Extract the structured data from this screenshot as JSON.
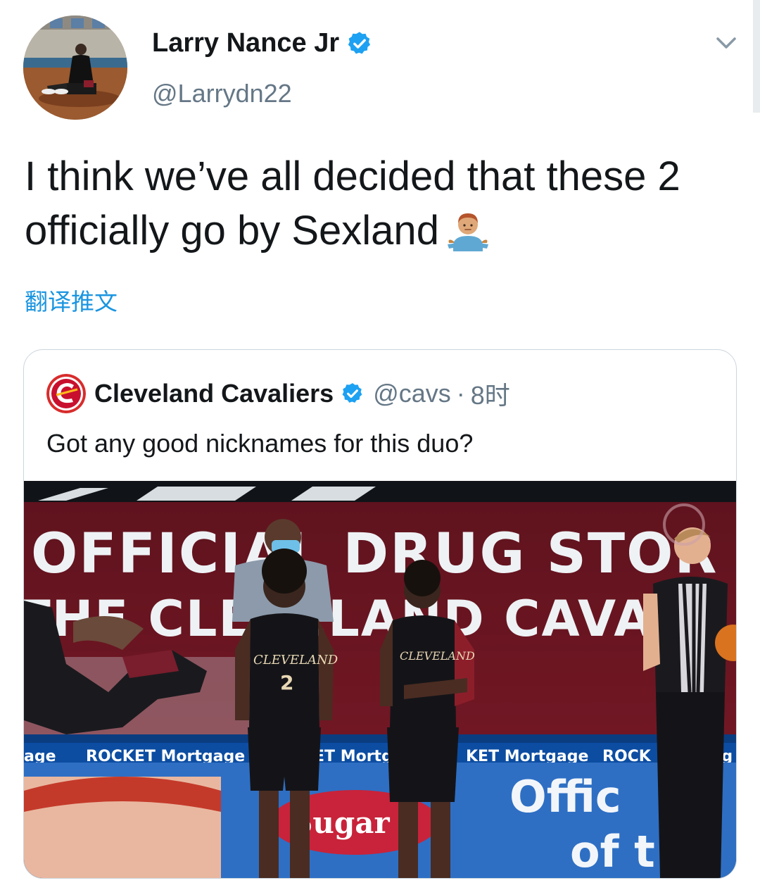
{
  "tweet": {
    "display_name": "Larry Nance Jr",
    "handle": "@Larrydn22",
    "text": "I think we’ve all decided that these 2 officially go by Sexland",
    "emoji_icon": "person-shrugging-emoji",
    "translate_label": "翻译推文"
  },
  "quote": {
    "display_name": "Cleveland Cavaliers",
    "handle": "@cavs",
    "separator": "·",
    "time": "8时",
    "text": "Got any good nicknames for this duo?",
    "media": {
      "banner_top": "OFFICIAL DRUG STOR",
      "banner_second": "THE CLEVELAND CAVA",
      "jersey_text": "CLEVELAND",
      "jersey_number": "2",
      "ad_rocket_1": "age",
      "ad_rocket_2": "ROCKET Mortgage",
      "ad_rocket_3": "ET Mortg",
      "ad_rocket_4": "KET Mortgage",
      "ad_rocket_5": "ROCK",
      "ad_rocket_6": "rtg",
      "ad_sugar": "Sugar",
      "ad_official": "Offic",
      "ad_of": "of t"
    }
  },
  "colors": {
    "link_blue": "#1b95e0",
    "verified_blue": "#1da1f2",
    "secondary_text": "#657786",
    "cavs_wine": "#6f263d",
    "cavs_gold": "#ffb81c"
  }
}
